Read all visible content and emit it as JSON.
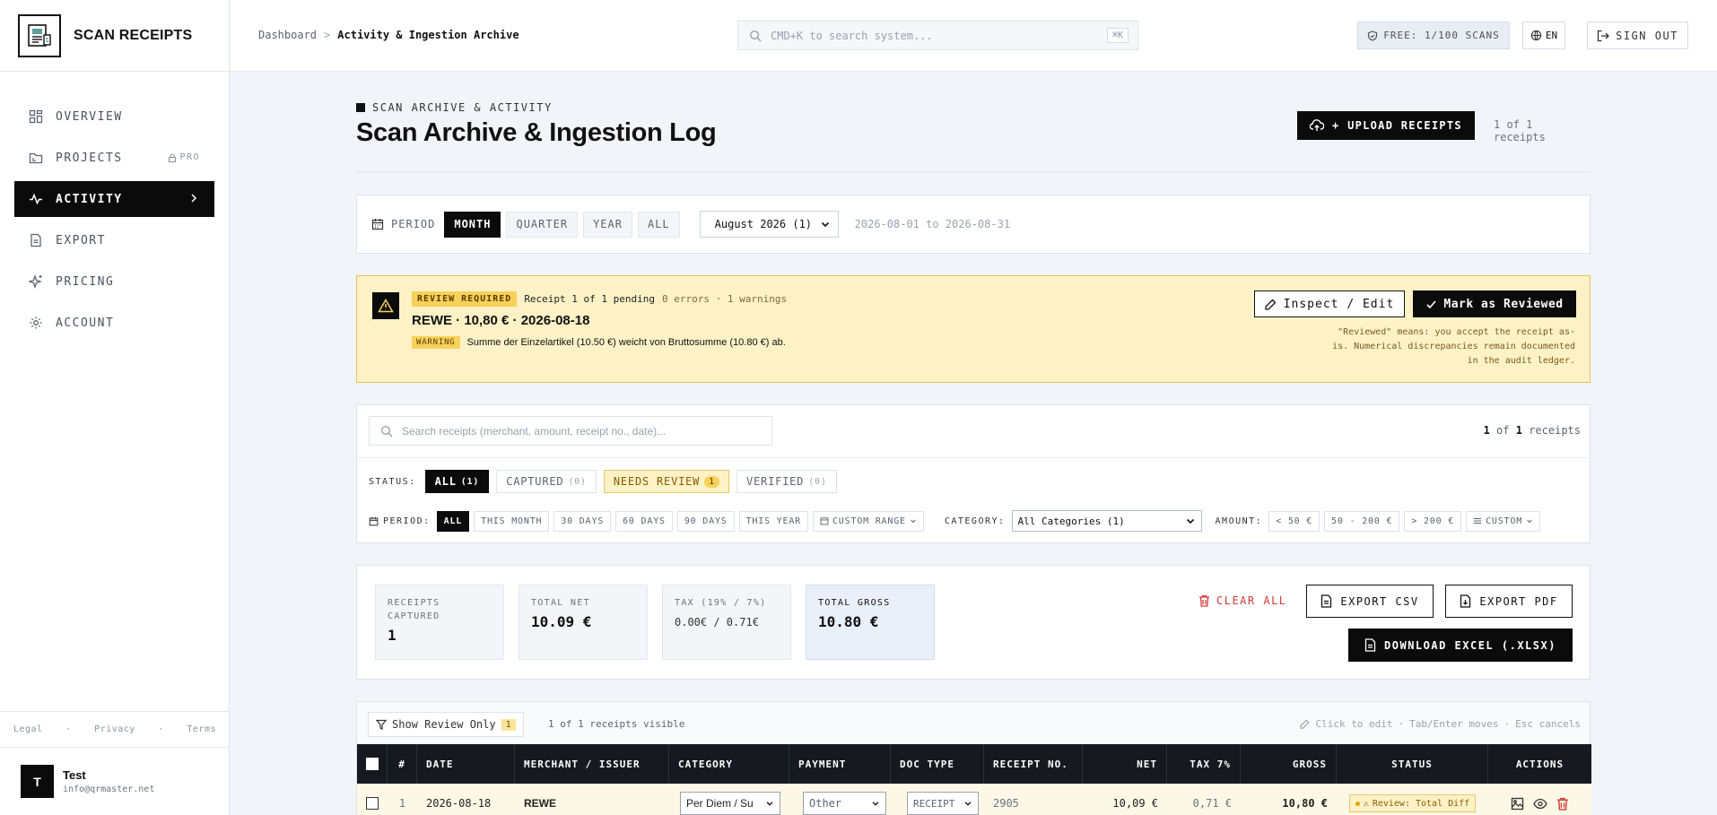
{
  "app": {
    "name": "SCAN RECEIPTS"
  },
  "sidebar": {
    "items": [
      {
        "label": "OVERVIEW",
        "icon": "grid-icon"
      },
      {
        "label": "PROJECTS",
        "icon": "folder-icon",
        "badge": "PRO"
      },
      {
        "label": "ACTIVITY",
        "icon": "pulse-icon",
        "active": true
      },
      {
        "label": "EXPORT",
        "icon": "file-icon"
      },
      {
        "label": "PRICING",
        "icon": "sparkle-icon"
      },
      {
        "label": "ACCOUNT",
        "icon": "gear-icon"
      }
    ],
    "footer": {
      "legal": "Legal",
      "privacy": "Privacy",
      "terms": "Terms",
      "separator": "·"
    },
    "user": {
      "initial": "T",
      "name": "Test",
      "email": "info@qrmaster.net"
    }
  },
  "header": {
    "breadcrumb": {
      "home": "Dashboard",
      "separator": ">",
      "current": "Activity & Ingestion Archive"
    },
    "search": {
      "placeholder": "CMD+K to search system...",
      "shortcut": "⌘K"
    },
    "plan": "FREE: 1/100 SCANS",
    "language": "EN",
    "signout": "SIGN OUT"
  },
  "page": {
    "tag": "SCAN ARCHIVE & ACTIVITY",
    "title": "Scan Archive & Ingestion Log",
    "upload_label": "+ UPLOAD RECEIPTS",
    "count": "1 of 1 receipts"
  },
  "period": {
    "label": "PERIOD",
    "options": [
      "MONTH",
      "QUARTER",
      "YEAR",
      "ALL"
    ],
    "active": "MONTH",
    "selected_month": "August 2026 (1)",
    "range": "2026-08-01 to 2026-08-31"
  },
  "review": {
    "badge": "REVIEW REQUIRED",
    "pending": "Receipt 1 of 1 pending",
    "stats": "0 errors · 1 warnings",
    "title": "REWE · 10,80 € · 2026-08-18",
    "warning_badge": "WARNING",
    "warning_text": "Summe der Einzelartikel (10.50 €) weicht von Bruttosumme (10.80 €) ab.",
    "inspect_label": "Inspect / Edit",
    "mark_label": "Mark as Reviewed",
    "note": "\"Reviewed\" means: you accept the receipt as-is. Numerical discrepancies remain documented in the audit ledger."
  },
  "filters": {
    "search_placeholder": "Search receipts (merchant, amount, receipt no., date)...",
    "count": {
      "shown": "1",
      "of": "of",
      "total": "1",
      "suffix": "receipts"
    },
    "status_label": "STATUS:",
    "status": [
      {
        "label": "ALL",
        "count": "(1)"
      },
      {
        "label": "CAPTURED",
        "count": "(0)"
      },
      {
        "label": "NEEDS REVIEW",
        "count": "1"
      },
      {
        "label": "VERIFIED",
        "count": "(0)"
      }
    ],
    "period_label": "PERIOD:",
    "periods": [
      "ALL",
      "THIS MONTH",
      "30 DAYS",
      "60 DAYS",
      "90 DAYS",
      "THIS YEAR"
    ],
    "custom_range": "CUSTOM RANGE",
    "category_label": "CATEGORY:",
    "category_value": "All Categories (1)",
    "amount_label": "AMOUNT:",
    "amounts": [
      "< 50 €",
      "50 - 200 €",
      "> 200 €"
    ],
    "custom": "CUSTOM"
  },
  "summary": {
    "receipts_label": "RECEIPTS CAPTURED",
    "receipts_value": "1",
    "net_label": "TOTAL NET",
    "net_value": "10.09 €",
    "tax_label": "TAX (19% / 7%)",
    "tax_value": "0.00€ / 0.71€",
    "gross_label": "TOTAL GROSS",
    "gross_value": "10.80 €",
    "clear_label": "CLEAR ALL",
    "csv_label": "EXPORT CSV",
    "pdf_label": "EXPORT PDF",
    "xlsx_label": "DOWNLOAD EXCEL (.XLSX)"
  },
  "table": {
    "review_only_label": "Show Review Only",
    "review_only_count": "1",
    "visible": "1 of 1 receipts visible",
    "hints": [
      "Click to edit",
      "Tab/Enter moves",
      "Esc cancels"
    ],
    "hint_sep": "·",
    "columns": [
      "#",
      "DATE",
      "MERCHANT / ISSUER",
      "CATEGORY",
      "PAYMENT",
      "DOC TYPE",
      "RECEIPT NO.",
      "NET",
      "TAX 7%",
      "GROSS",
      "STATUS",
      "ACTIONS"
    ],
    "rows": [
      {
        "num": "1",
        "date": "2026-08-18",
        "merchant": "REWE",
        "category": "Per Diem / Su",
        "payment": "Other",
        "doc_type": "RECEIPT",
        "receipt_no": "2905",
        "net": "10,09 €",
        "tax": "0,71 €",
        "gross": "10,80 €",
        "status": "Review: Total Diff"
      }
    ]
  },
  "colors": {
    "accent": "#0b0b0b",
    "warning_bg": "#fdf2c6",
    "warning_border": "#e2c458",
    "danger": "#d23a3a",
    "background": "#f1f4f9"
  }
}
